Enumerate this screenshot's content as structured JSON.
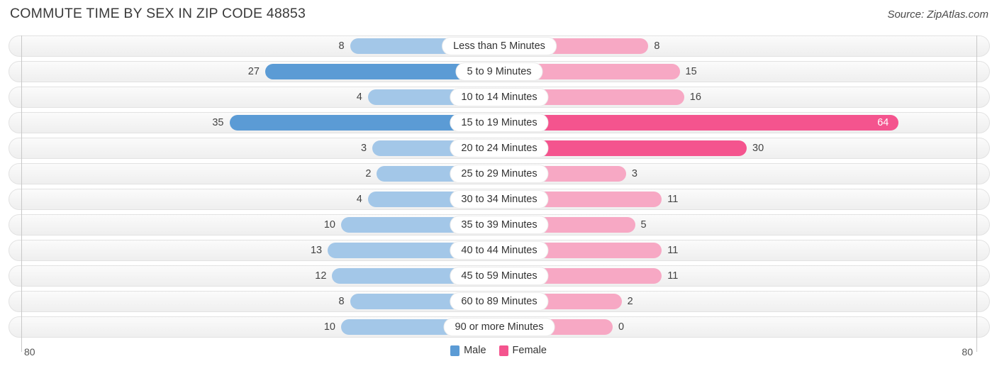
{
  "header": {
    "title": "COMMUTE TIME BY SEX IN ZIP CODE 48853",
    "source": "Source: ZipAtlas.com"
  },
  "axis": {
    "left_tick": "80",
    "right_tick": "80"
  },
  "legend": {
    "items": [
      {
        "label": "Male",
        "color": "#5b9bd5"
      },
      {
        "label": "Female",
        "color": "#f4548e"
      }
    ]
  },
  "colors": {
    "male_strong": "#5b9bd5",
    "male_light": "#a3c7e8",
    "female_strong": "#f4548e",
    "female_light": "#f7a8c4",
    "track_border": "#e2e2e2",
    "axis_line": "#c8c8c8"
  },
  "chart_data": {
    "type": "bar",
    "orientation": "horizontal-diverging",
    "title": "COMMUTE TIME BY SEX IN ZIP CODE 48853",
    "xlabel": "",
    "ylabel": "",
    "xlim": [
      80,
      80
    ],
    "axis_max": 80,
    "grid": false,
    "legend_position": "bottom-center",
    "categories": [
      "Less than 5 Minutes",
      "5 to 9 Minutes",
      "10 to 14 Minutes",
      "15 to 19 Minutes",
      "20 to 24 Minutes",
      "25 to 29 Minutes",
      "30 to 34 Minutes",
      "35 to 39 Minutes",
      "40 to 44 Minutes",
      "45 to 59 Minutes",
      "60 to 89 Minutes",
      "90 or more Minutes"
    ],
    "series": [
      {
        "name": "Male",
        "values": [
          8,
          27,
          4,
          35,
          3,
          2,
          4,
          10,
          13,
          12,
          8,
          10
        ]
      },
      {
        "name": "Female",
        "values": [
          8,
          15,
          16,
          64,
          30,
          3,
          11,
          5,
          11,
          11,
          2,
          0
        ]
      }
    ]
  }
}
